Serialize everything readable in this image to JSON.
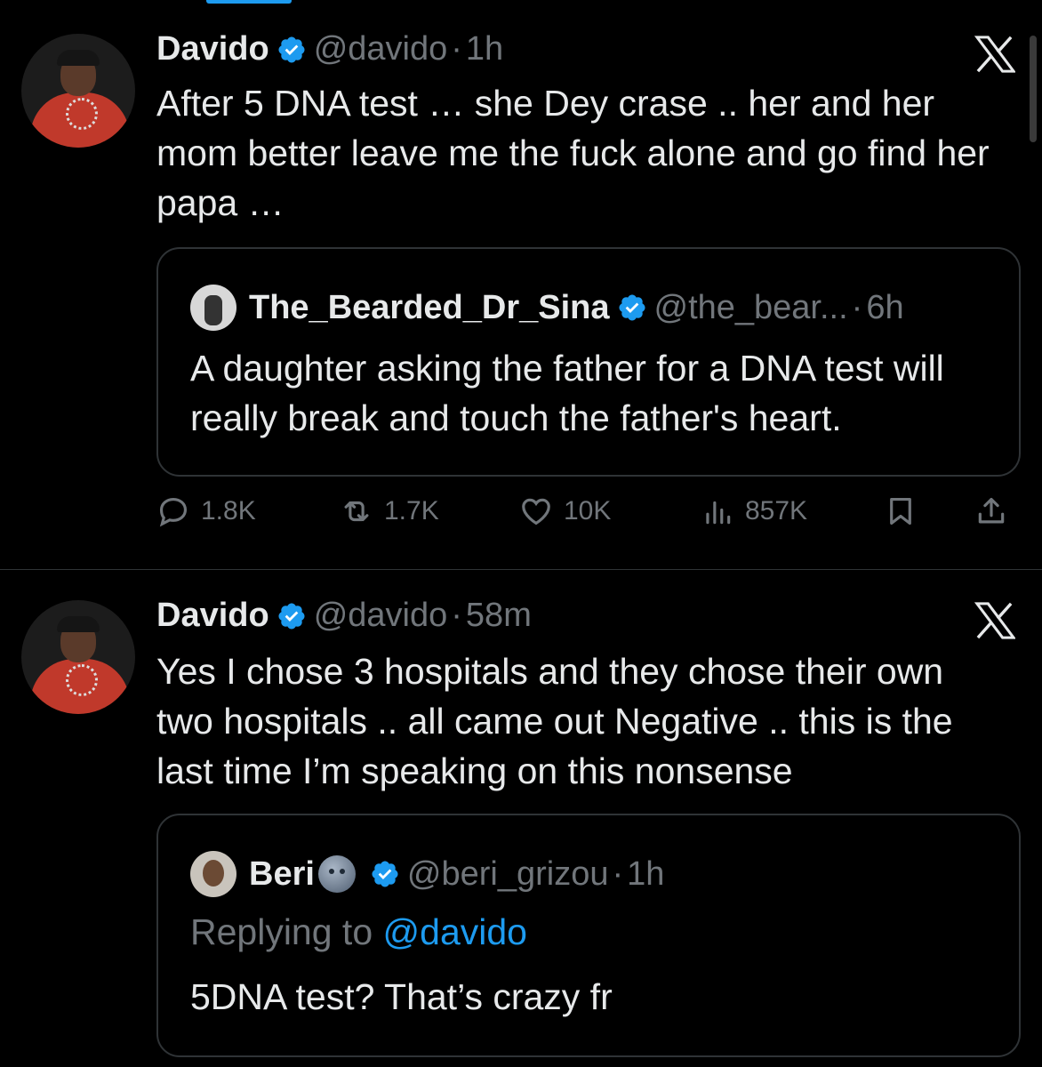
{
  "tweets": [
    {
      "author": {
        "name": "Davido",
        "handle": "@davido",
        "verified": true
      },
      "time": "1h",
      "text": "After 5 DNA test … she Dey crase .. her and her mom better leave me the fuck alone  and go find her papa …",
      "quote": {
        "author": {
          "name": "The_Bearded_Dr_Sina",
          "handle": "@the_bear...",
          "verified": true
        },
        "time": "6h",
        "text": "A daughter asking the father for a DNA test will really break and touch the father's heart."
      },
      "stats": {
        "replies": "1.8K",
        "retweets": "1.7K",
        "likes": "10K",
        "views": "857K"
      }
    },
    {
      "author": {
        "name": "Davido",
        "handle": "@davido",
        "verified": true
      },
      "time": "58m",
      "text": "Yes I chose 3 hospitals and they chose their own two hospitals .. all came out Negative .. this is the last time I’m speaking on this nonsense",
      "quote": {
        "author": {
          "name": "Beri",
          "handle": "@beri_grizou",
          "verified": true
        },
        "time": "1h",
        "replying_prefix": "Replying to ",
        "replying_to": "@davido",
        "text": "5DNA test? That’s crazy fr"
      }
    }
  ],
  "separator": "·",
  "colors": {
    "background": "#000000",
    "text": "#e7e9ea",
    "muted": "#71767b",
    "accent": "#1d9bf0",
    "border": "#2f3336"
  },
  "icons": [
    "verified-badge-icon",
    "x-logo-icon",
    "reply-icon",
    "retweet-icon",
    "like-icon",
    "views-icon",
    "bookmark-icon",
    "share-icon",
    "moon-emoji-icon"
  ]
}
